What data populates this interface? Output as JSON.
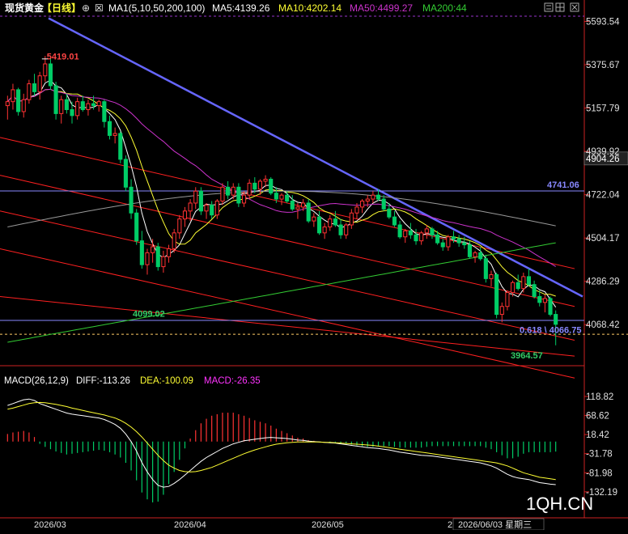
{
  "colors": {
    "background": "#000000",
    "up": "#ff3333",
    "down": "#00cc66",
    "ma5": "#ffffff",
    "ma10": "#ffff33",
    "ma50": "#cc33cc",
    "ma200": "#33cc33",
    "ma100": "#999999",
    "trend": "#6666ff",
    "channel": "#ff2020",
    "hline": "#8888ff",
    "axis_text": "#e0e0e0",
    "title_text": "#ffffff",
    "macd_label": "#ffffff",
    "dif": "#ffffff",
    "dea": "#ffff33",
    "macd": "#ff33ff",
    "watermark": "#ffffff"
  },
  "header": {
    "title": "现货黄金",
    "period": "【日线】",
    "ma_label": "MA1(5,10,50,200,100)",
    "ma5": "MA5:4139.26",
    "ma10": "MA10:4202.14",
    "ma50": "MA50:4499.27",
    "ma200": "MA200:44",
    "icons": [
      "plus-circle-icon",
      "grid-icon",
      "menu-icon",
      "close-icon"
    ]
  },
  "macd_header": {
    "label": "MACD(26,12,9)",
    "diff": "DIFF:-113.26",
    "dea": "DEA:-100.09",
    "macd": "MACD:-26.35"
  },
  "annotations": {
    "high_label": "5419.01",
    "low_label_1": "4099.02",
    "fib_label": "0.618 \\ 4066.75",
    "low_label_2": "3964.57",
    "hline_label": "4741.06",
    "right_box_1": "4904.26",
    "right_box_2": "4068.42"
  },
  "footer": {
    "watermark": "1QH.CN",
    "date_label": "2026/06/03 星期三",
    "x_ticks": [
      "2026/03",
      "2026/04",
      "2026/05",
      "2"
    ]
  },
  "chart_data": [
    {
      "type": "candlestick",
      "title": "现货黄金【日线】",
      "ylim": [
        3870,
        5620
      ],
      "yticks": [
        "5593.54",
        "5375.67",
        "5157.79",
        "4939.92",
        "4722.04",
        "4504.17",
        "4286.29",
        "4068.42"
      ],
      "ytick_values": [
        5593.54,
        5375.67,
        5157.79,
        4939.92,
        4722.04,
        4504.17,
        4286.29,
        4068.42
      ],
      "candles": [
        [
          5170,
          5220,
          5100,
          5190
        ],
        [
          5190,
          5280,
          5150,
          5250
        ],
        [
          5250,
          5260,
          5120,
          5140
        ],
        [
          5140,
          5230,
          5110,
          5200
        ],
        [
          5200,
          5300,
          5180,
          5280
        ],
        [
          5280,
          5330,
          5220,
          5240
        ],
        [
          5240,
          5340,
          5200,
          5320
        ],
        [
          5320,
          5420,
          5290,
          5380
        ],
        [
          5380,
          5410,
          5250,
          5270
        ],
        [
          5270,
          5290,
          5100,
          5130
        ],
        [
          5130,
          5220,
          5080,
          5200
        ],
        [
          5200,
          5230,
          5130,
          5150
        ],
        [
          5150,
          5190,
          5080,
          5120
        ],
        [
          5120,
          5210,
          5100,
          5190
        ],
        [
          5190,
          5220,
          5140,
          5150
        ],
        [
          5150,
          5200,
          5120,
          5180
        ],
        [
          5180,
          5220,
          5150,
          5170
        ],
        [
          5170,
          5200,
          5140,
          5190
        ],
        [
          5190,
          5200,
          5060,
          5090
        ],
        [
          5090,
          5120,
          5000,
          5020
        ],
        [
          5020,
          5060,
          4980,
          5030
        ],
        [
          5030,
          5040,
          4880,
          4900
        ],
        [
          4900,
          4920,
          4740,
          4760
        ],
        [
          4760,
          4800,
          4600,
          4630
        ],
        [
          4630,
          4650,
          4470,
          4490
        ],
        [
          4490,
          4540,
          4350,
          4370
        ],
        [
          4370,
          4450,
          4320,
          4430
        ],
        [
          4430,
          4500,
          4380,
          4460
        ],
        [
          4460,
          4480,
          4340,
          4360
        ],
        [
          4360,
          4440,
          4330,
          4410
        ],
        [
          4410,
          4470,
          4380,
          4450
        ],
        [
          4450,
          4550,
          4430,
          4530
        ],
        [
          4530,
          4620,
          4500,
          4600
        ],
        [
          4600,
          4660,
          4560,
          4640
        ],
        [
          4640,
          4700,
          4590,
          4680
        ],
        [
          4680,
          4760,
          4650,
          4740
        ],
        [
          4740,
          4760,
          4620,
          4640
        ],
        [
          4640,
          4680,
          4600,
          4670
        ],
        [
          4670,
          4690,
          4600,
          4620
        ],
        [
          4620,
          4700,
          4600,
          4690
        ],
        [
          4690,
          4780,
          4670,
          4760
        ],
        [
          4760,
          4790,
          4700,
          4720
        ],
        [
          4720,
          4780,
          4700,
          4760
        ],
        [
          4760,
          4780,
          4660,
          4680
        ],
        [
          4680,
          4740,
          4660,
          4720
        ],
        [
          4720,
          4800,
          4700,
          4780
        ],
        [
          4780,
          4810,
          4730,
          4750
        ],
        [
          4750,
          4800,
          4720,
          4790
        ],
        [
          4790,
          4820,
          4760,
          4800
        ],
        [
          4800,
          4810,
          4720,
          4730
        ],
        [
          4730,
          4760,
          4680,
          4700
        ],
        [
          4700,
          4730,
          4670,
          4720
        ],
        [
          4720,
          4740,
          4680,
          4690
        ],
        [
          4690,
          4720,
          4640,
          4650
        ],
        [
          4650,
          4680,
          4600,
          4660
        ],
        [
          4660,
          4700,
          4640,
          4680
        ],
        [
          4680,
          4700,
          4580,
          4590
        ],
        [
          4590,
          4630,
          4560,
          4610
        ],
        [
          4610,
          4640,
          4520,
          4530
        ],
        [
          4530,
          4580,
          4500,
          4560
        ],
        [
          4560,
          4620,
          4540,
          4600
        ],
        [
          4600,
          4640,
          4560,
          4570
        ],
        [
          4570,
          4600,
          4500,
          4520
        ],
        [
          4520,
          4580,
          4500,
          4570
        ],
        [
          4570,
          4650,
          4550,
          4630
        ],
        [
          4630,
          4680,
          4600,
          4660
        ],
        [
          4660,
          4700,
          4630,
          4690
        ],
        [
          4690,
          4720,
          4660,
          4700
        ],
        [
          4700,
          4740,
          4680,
          4720
        ],
        [
          4720,
          4750,
          4690,
          4700
        ],
        [
          4700,
          4720,
          4640,
          4650
        ],
        [
          4650,
          4680,
          4600,
          4610
        ],
        [
          4610,
          4640,
          4560,
          4570
        ],
        [
          4570,
          4590,
          4500,
          4510
        ],
        [
          4510,
          4550,
          4480,
          4540
        ],
        [
          4540,
          4580,
          4500,
          4520
        ],
        [
          4520,
          4550,
          4470,
          4490
        ],
        [
          4490,
          4540,
          4470,
          4530
        ],
        [
          4530,
          4570,
          4500,
          4550
        ],
        [
          4550,
          4560,
          4500,
          4520
        ],
        [
          4520,
          4540,
          4470,
          4480
        ],
        [
          4480,
          4500,
          4440,
          4460
        ],
        [
          4460,
          4520,
          4440,
          4510
        ],
        [
          4510,
          4540,
          4480,
          4500
        ],
        [
          4500,
          4520,
          4460,
          4480
        ],
        [
          4480,
          4510,
          4450,
          4470
        ],
        [
          4470,
          4490,
          4400,
          4410
        ],
        [
          4410,
          4440,
          4380,
          4430
        ],
        [
          4430,
          4460,
          4390,
          4400
        ],
        [
          4400,
          4420,
          4280,
          4300
        ],
        [
          4300,
          4340,
          4260,
          4320
        ],
        [
          4320,
          4330,
          4100,
          4120
        ],
        [
          4120,
          4180,
          4080,
          4160
        ],
        [
          4160,
          4240,
          4140,
          4230
        ],
        [
          4230,
          4290,
          4210,
          4280
        ],
        [
          4280,
          4320,
          4240,
          4250
        ],
        [
          4250,
          4330,
          4230,
          4310
        ],
        [
          4310,
          4350,
          4260,
          4270
        ],
        [
          4270,
          4290,
          4200,
          4210
        ],
        [
          4210,
          4240,
          4160,
          4180
        ],
        [
          4180,
          4220,
          4130,
          4200
        ],
        [
          4200,
          4210,
          4110,
          4120
        ],
        [
          4120,
          4140,
          3964.57,
          4070
        ]
      ],
      "annotations": {
        "high": 5419.01,
        "low_1": 4099.02,
        "low_2": 3964.57,
        "fib_0618": 4066.75,
        "hline": 4741.06
      }
    },
    {
      "type": "macd",
      "title": "MACD(26,12,9)",
      "ylim": [
        -190,
        140
      ],
      "yticks": [
        "118.82",
        "68.62",
        "18.42",
        "-31.78",
        "-81.98",
        "-132.19"
      ],
      "ytick_values": [
        118.82,
        68.62,
        18.42,
        -31.78,
        -81.98,
        -132.19
      ],
      "diff": [
        95,
        100,
        105,
        110,
        112,
        108,
        100,
        95,
        90,
        85,
        80,
        75,
        72,
        70,
        68,
        66,
        64,
        62,
        58,
        52,
        45,
        35,
        20,
        0,
        -25,
        -55,
        -80,
        -100,
        -115,
        -120,
        -118,
        -110,
        -100,
        -88,
        -76,
        -64,
        -52,
        -42,
        -34,
        -26,
        -18,
        -12,
        -6,
        -2,
        2,
        4,
        6,
        8,
        10,
        11,
        10,
        9,
        8,
        6,
        4,
        3,
        1,
        0,
        -1,
        -2,
        -3,
        -4,
        -6,
        -8,
        -10,
        -12,
        -14,
        -16,
        -17,
        -18,
        -20,
        -22,
        -25,
        -28,
        -30,
        -32,
        -34,
        -36,
        -37,
        -38,
        -40,
        -42,
        -44,
        -46,
        -48,
        -50,
        -52,
        -54,
        -56,
        -60,
        -64,
        -70,
        -78,
        -86,
        -92,
        -96,
        -98,
        -100,
        -104,
        -108,
        -110,
        -112,
        -113.26
      ],
      "dea": [
        85,
        88,
        92,
        96,
        100,
        102,
        103,
        102,
        100,
        98,
        95,
        92,
        88,
        85,
        82,
        79,
        76,
        73,
        70,
        66,
        62,
        56,
        48,
        38,
        26,
        12,
        -4,
        -20,
        -36,
        -50,
        -62,
        -70,
        -76,
        -79,
        -80,
        -79,
        -76,
        -72,
        -68,
        -62,
        -56,
        -50,
        -44,
        -38,
        -32,
        -27,
        -22,
        -18,
        -14,
        -10,
        -7,
        -5,
        -3,
        -2,
        -1,
        -1,
        -1,
        -1,
        -1,
        -2,
        -2,
        -3,
        -4,
        -5,
        -6,
        -7,
        -8,
        -9,
        -10,
        -12,
        -14,
        -16,
        -18,
        -20,
        -22,
        -24,
        -26,
        -28,
        -30,
        -32,
        -34,
        -36,
        -38,
        -40,
        -42,
        -44,
        -46,
        -48,
        -50,
        -52,
        -54,
        -56,
        -60,
        -64,
        -70,
        -76,
        -82,
        -86,
        -90,
        -94,
        -96,
        -98,
        -100.09
      ],
      "macd": [
        20,
        24,
        26,
        28,
        24,
        12,
        -6,
        -14,
        -20,
        -26,
        -30,
        -34,
        -32,
        -30,
        -28,
        -26,
        -24,
        -22,
        -24,
        -28,
        -34,
        -42,
        -56,
        -76,
        -102,
        -134,
        -152,
        -160,
        -158,
        -140,
        -112,
        -80,
        -48,
        -18,
        8,
        30,
        48,
        60,
        68,
        72,
        76,
        76,
        76,
        72,
        68,
        62,
        56,
        52,
        48,
        42,
        34,
        28,
        22,
        16,
        10,
        8,
        4,
        2,
        0,
        0,
        -2,
        -2,
        -4,
        -6,
        -8,
        -10,
        -12,
        -14,
        -14,
        -12,
        -12,
        -12,
        -14,
        -16,
        -16,
        -16,
        -16,
        -16,
        -14,
        -12,
        -12,
        -12,
        -12,
        -12,
        -12,
        -12,
        -12,
        -12,
        -12,
        -16,
        -20,
        -28,
        -36,
        -44,
        -44,
        -40,
        -32,
        -28,
        -28,
        -28,
        -28,
        -28,
        -26.35
      ]
    }
  ]
}
